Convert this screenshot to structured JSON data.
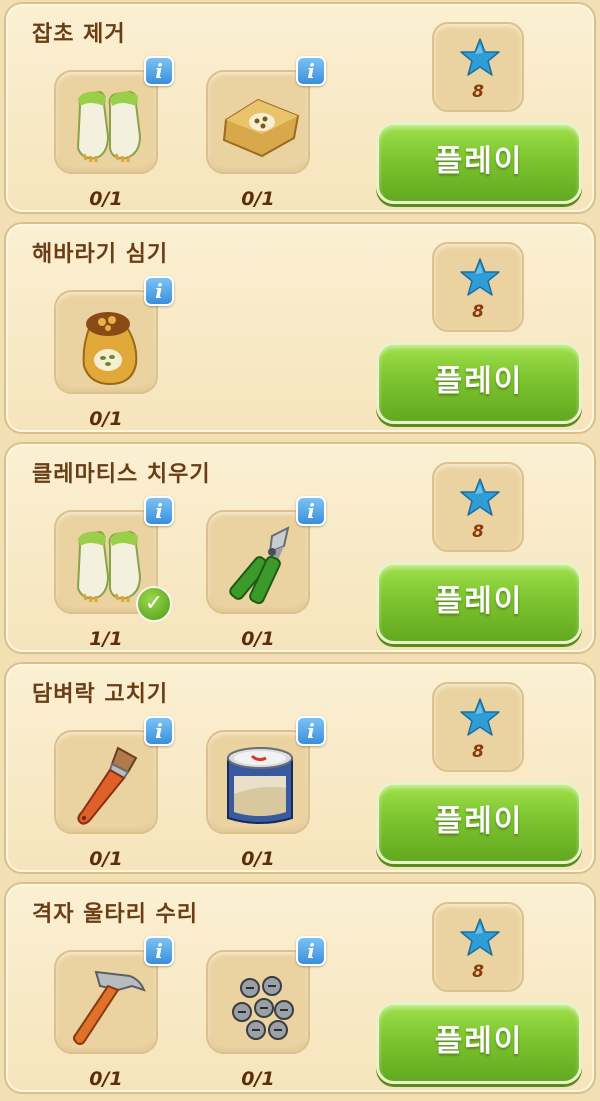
{
  "tasks": [
    {
      "title": "잡초 제거",
      "items": [
        {
          "icon": "garden-gloves-icon",
          "count": "0/1",
          "info": "i",
          "done": false
        },
        {
          "icon": "seed-bag-flat-icon",
          "count": "0/1",
          "info": "i",
          "done": false
        }
      ],
      "reward": {
        "icon": "blue-star-icon",
        "count": "8"
      },
      "play_label": "플레이"
    },
    {
      "title": "해바라기 심기",
      "items": [
        {
          "icon": "seed-sack-icon",
          "count": "0/1",
          "info": "i",
          "done": false
        }
      ],
      "reward": {
        "icon": "blue-star-icon",
        "count": "8"
      },
      "play_label": "플레이"
    },
    {
      "title": "클레마티스 치우기",
      "items": [
        {
          "icon": "garden-gloves-icon",
          "count": "1/1",
          "info": "i",
          "done": true,
          "badge": "✓"
        },
        {
          "icon": "pruning-shears-icon",
          "count": "0/1",
          "info": "i",
          "done": false
        }
      ],
      "reward": {
        "icon": "blue-star-icon",
        "count": "8"
      },
      "play_label": "플레이"
    },
    {
      "title": "담벼락 고치기",
      "items": [
        {
          "icon": "paint-brush-icon",
          "count": "0/1",
          "info": "i",
          "done": false
        },
        {
          "icon": "paint-can-icon",
          "count": "0/1",
          "info": "i",
          "done": false
        }
      ],
      "reward": {
        "icon": "blue-star-icon",
        "count": "8"
      },
      "play_label": "플레이"
    },
    {
      "title": "격자 울타리 수리",
      "items": [
        {
          "icon": "hammer-icon",
          "count": "0/1",
          "info": "i",
          "done": false
        },
        {
          "icon": "screws-icon",
          "count": "0/1",
          "info": "i",
          "done": false
        }
      ],
      "reward": {
        "icon": "blue-star-icon",
        "count": "8"
      },
      "play_label": "플레이"
    }
  ],
  "colors": {
    "card_bg": "#f8e9c4",
    "title_text": "#6a3d14",
    "play_green": "#7dc430",
    "info_blue": "#3a8fdb",
    "star_blue": "#2f9ed6"
  }
}
